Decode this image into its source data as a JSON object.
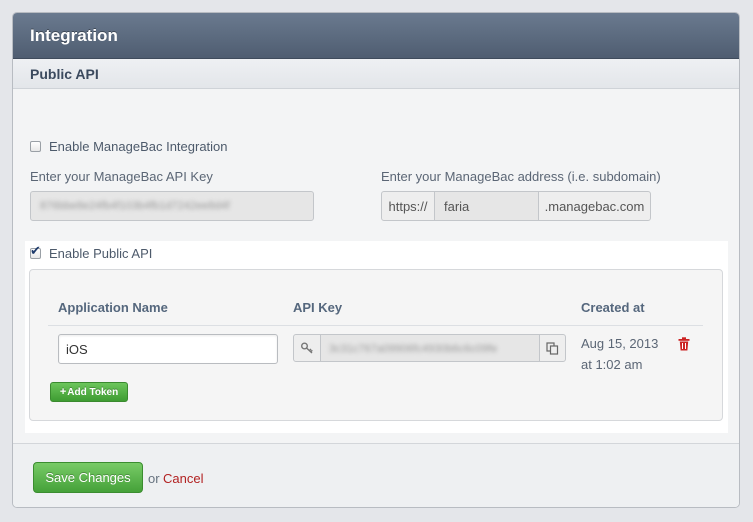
{
  "header": {
    "title": "Integration"
  },
  "section": {
    "title": "Public API"
  },
  "integration": {
    "enable_label": "Enable ManageBac Integration",
    "enabled": false,
    "api_key_label": "Enter your ManageBac API Key",
    "api_key_value": "876bbe8e24fb4f103b4fb1d7242ee8d4f",
    "address_label": "Enter your ManageBac address (i.e. subdomain)",
    "address_prefix": "https://",
    "address_value": "faria",
    "address_suffix": ".managebac.com"
  },
  "public_api": {
    "enable_label": "Enable Public API",
    "enabled": true,
    "columns": {
      "app_name": "Application Name",
      "api_key": "API Key",
      "created_at": "Created at"
    },
    "tokens": [
      {
        "app_name": "iOS",
        "api_key": "3c31c767a09906fc4930b6c6c09fe",
        "created_date": "Aug 15, 2013",
        "created_time": "at 1:02 am"
      }
    ],
    "add_token_label": "Add Token",
    "add_token_icon": "+"
  },
  "footer": {
    "save_label": "Save Changes",
    "or_text": "or",
    "cancel_label": "Cancel"
  },
  "colors": {
    "header_bg": "#5b6a7e",
    "button_green": "#4fa844",
    "cancel_red": "#b22222",
    "trash_red": "#cc2222"
  },
  "icons": {
    "key": "key-icon",
    "copy": "copy-icon",
    "trash": "trash-icon"
  }
}
